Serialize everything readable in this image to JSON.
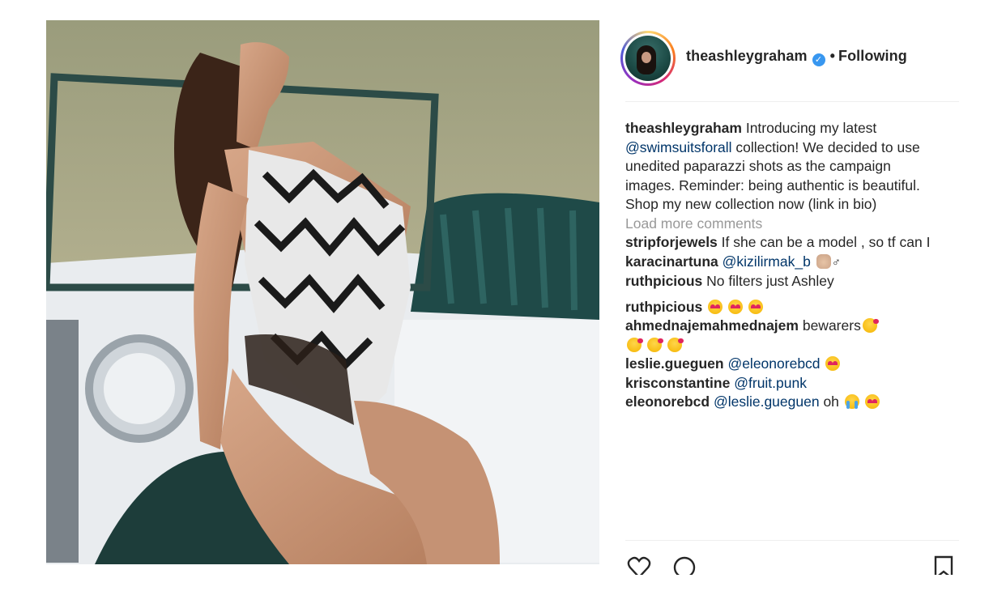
{
  "post": {
    "username": "theashleygraham",
    "verified_icon": "verified-badge-icon",
    "separator": "•",
    "follow_status": "Following",
    "caption": {
      "username": "theashleygraham",
      "text_before": "Introducing my latest ",
      "mention": "@swimsuitsforall",
      "text_after": " collection! We decided to use unedited paparazzi shots as the campaign images. Reminder: being authentic is beautiful. Shop my new collection now (link in bio)"
    },
    "load_more": "Load more comments",
    "comments": [
      {
        "username": "stripforjewels",
        "text": "If she can be a model , so tf can I"
      },
      {
        "username": "karacinartuna",
        "mention": "@kizilirmak_b",
        "suffix": "♂"
      },
      {
        "username": "ruthpicious",
        "text": "No filters just Ashley"
      },
      {
        "username": "ruthpicious"
      },
      {
        "username": "ahmednajemahmednajem",
        "text": "bewarers"
      },
      {
        "username": "leslie.gueguen",
        "mention": "@eleonorebcd"
      },
      {
        "username": "krisconstantine",
        "mention": "@fruit.punk"
      },
      {
        "username": "eleonorebcd",
        "mention": "@leslie.gueguen",
        "text": "oh"
      }
    ],
    "actions": [
      "heart-icon",
      "comment-icon",
      "bookmark-icon"
    ]
  },
  "colors": {
    "link": "#003569",
    "muted": "#999999",
    "verified": "#3897f0",
    "text": "#262626"
  }
}
